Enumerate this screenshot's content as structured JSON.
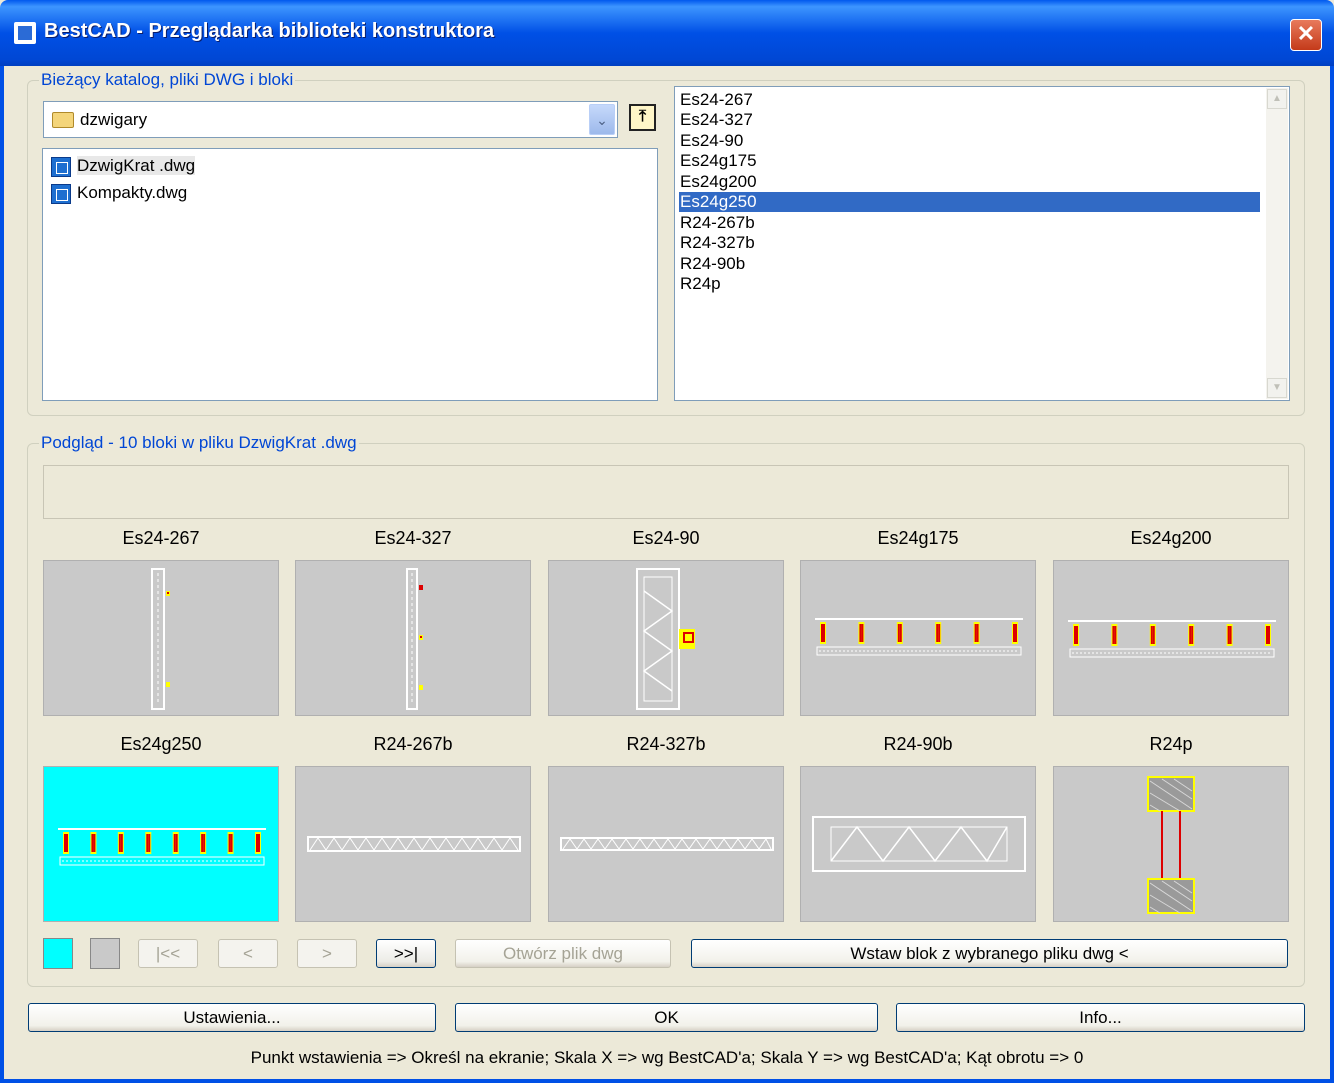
{
  "window": {
    "title": "BestCAD - Przeglądarka biblioteki konstruktora",
    "close_glyph": "✕"
  },
  "catalog": {
    "group_label": "Bieżący katalog, pliki DWG i bloki",
    "folder_value": "dzwigary",
    "dropdown_glyph": "⌄",
    "up_folder_glyph": "⤒",
    "files": [
      "DzwigKrat .dwg",
      "Kompakty.dwg"
    ],
    "blocks": [
      "Es24-267",
      "Es24-327",
      "Es24-90",
      "Es24g175",
      "Es24g200",
      "Es24g250",
      "R24-267b",
      "R24-327b",
      "R24-90b",
      "R24p"
    ],
    "selected_block": "Es24g250"
  },
  "preview": {
    "group_label": "Podgląd - 10 bloki w pliku DzwigKrat .dwg",
    "thumbnails": [
      {
        "label": "Es24-267"
      },
      {
        "label": "Es24-327"
      },
      {
        "label": "Es24-90"
      },
      {
        "label": "Es24g175"
      },
      {
        "label": "Es24g200"
      },
      {
        "label": "Es24g250",
        "selected": true
      },
      {
        "label": "R24-267b"
      },
      {
        "label": "R24-327b"
      },
      {
        "label": "R24-90b"
      },
      {
        "label": "R24p"
      }
    ],
    "swatch_colors": [
      "#00ffff",
      "#c9c9c9"
    ],
    "nav": {
      "first": "|<<",
      "prev": "<",
      "next": ">",
      "last": ">>|"
    },
    "open_dwg_label": "Otwórz plik dwg",
    "insert_label": "Wstaw blok z wybranego pliku dwg <"
  },
  "buttons": {
    "settings": "Ustawienia...",
    "ok": "OK",
    "info": "Info..."
  },
  "status": "Punkt wstawienia => Określ na ekranie; Skala X => wg BestCAD'a; Skala Y => wg BestCAD'a; Kąt obrotu => 0"
}
